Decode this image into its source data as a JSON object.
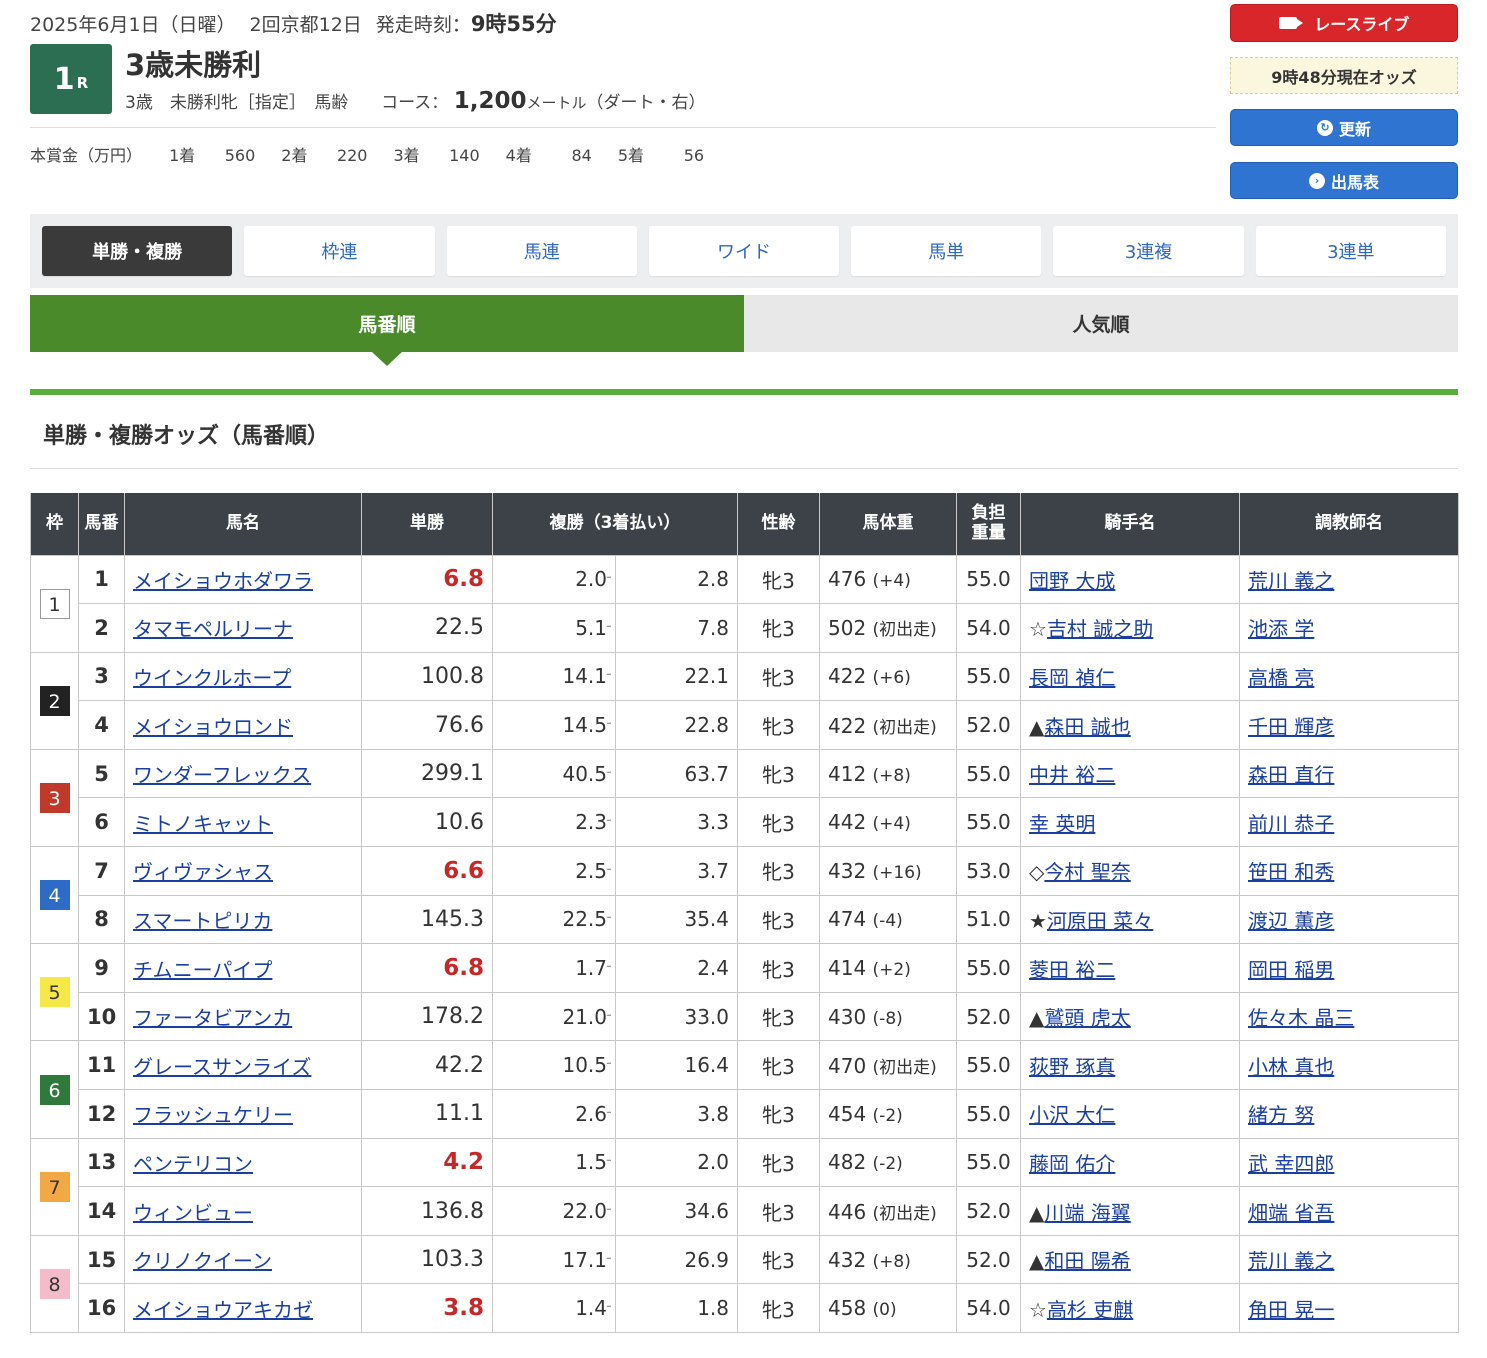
{
  "header": {
    "date": "2025年6月1日（日曜）",
    "meeting": "2回京都12日",
    "start_label": "発走時刻：",
    "start_time": "9時55分",
    "race_num": "1",
    "race_suffix": "R",
    "race_name": "3歳未勝利",
    "conditions": "3歳　未勝利牝［指定］　馬齢",
    "course_label": "コース：",
    "distance": "1,200",
    "unit": "メートル",
    "track": "（ダート・右）",
    "prize_label": "本賞金（万円）",
    "prizes": [
      {
        "place": "1着",
        "amount": "560"
      },
      {
        "place": "2着",
        "amount": "220"
      },
      {
        "place": "3着",
        "amount": "140"
      },
      {
        "place": "4着",
        "amount": "84"
      },
      {
        "place": "5着",
        "amount": "56"
      }
    ]
  },
  "side": {
    "live_label": "レースライブ",
    "odds_time": "9時48分現在オッズ",
    "update_label": "更新",
    "card_label": "出馬表"
  },
  "bet_tabs": [
    "単勝・複勝",
    "枠連",
    "馬連",
    "ワイド",
    "馬単",
    "3連複",
    "3連単"
  ],
  "sort_tabs": [
    "馬番順",
    "人気順"
  ],
  "section_title": "単勝・複勝オッズ（馬番順）",
  "columns": {
    "waku": "枠",
    "umaban": "馬番",
    "name": "馬名",
    "win": "単勝",
    "place": "複勝（3着払い）",
    "sex": "性齢",
    "weight": "馬体重",
    "burden1": "負担",
    "burden2": "重量",
    "jockey": "騎手名",
    "trainer": "調教師名"
  },
  "waku_colors": {
    "1": {
      "bg": "#ffffff",
      "fg": "#333333",
      "border": "#999999"
    },
    "2": {
      "bg": "#222222",
      "fg": "#ffffff",
      "border": "#222222"
    },
    "3": {
      "bg": "#c0392b",
      "fg": "#ffffff",
      "border": "#c0392b"
    },
    "4": {
      "bg": "#2e6bc4",
      "fg": "#ffffff",
      "border": "#2e6bc4"
    },
    "5": {
      "bg": "#f7e84a",
      "fg": "#333333",
      "border": "#f7e84a"
    },
    "6": {
      "bg": "#2f7a3a",
      "fg": "#ffffff",
      "border": "#2f7a3a"
    },
    "7": {
      "bg": "#f2a844",
      "fg": "#333333",
      "border": "#f2a844"
    },
    "8": {
      "bg": "#f4bccb",
      "fg": "#333333",
      "border": "#f4bccb"
    }
  },
  "horses": [
    {
      "waku": "1",
      "num": "1",
      "name": "メイショウホダワラ",
      "win": "6.8",
      "pop": true,
      "plc_lo": "2.0",
      "plc_hi": "2.8",
      "sex": "牝3",
      "wt": "476",
      "diff": "(+4)",
      "burden": "55.0",
      "mark": "",
      "jockey": "団野 大成",
      "trainer": "荒川 義之"
    },
    {
      "waku": "1",
      "num": "2",
      "name": "タマモペルリーナ",
      "win": "22.5",
      "pop": false,
      "plc_lo": "5.1",
      "plc_hi": "7.8",
      "sex": "牝3",
      "wt": "502",
      "diff": "(初出走)",
      "burden": "54.0",
      "mark": "☆",
      "jockey": "吉村 誠之助",
      "trainer": "池添 学"
    },
    {
      "waku": "2",
      "num": "3",
      "name": "ウインクルホープ",
      "win": "100.8",
      "pop": false,
      "plc_lo": "14.1",
      "plc_hi": "22.1",
      "sex": "牝3",
      "wt": "422",
      "diff": "(+6)",
      "burden": "55.0",
      "mark": "",
      "jockey": "長岡 禎仁",
      "trainer": "高橋 亮"
    },
    {
      "waku": "2",
      "num": "4",
      "name": "メイショウロンド",
      "win": "76.6",
      "pop": false,
      "plc_lo": "14.5",
      "plc_hi": "22.8",
      "sex": "牝3",
      "wt": "422",
      "diff": "(初出走)",
      "burden": "52.0",
      "mark": "▲",
      "jockey": "森田 誠也",
      "trainer": "千田 輝彦"
    },
    {
      "waku": "3",
      "num": "5",
      "name": "ワンダーフレックス",
      "win": "299.1",
      "pop": false,
      "plc_lo": "40.5",
      "plc_hi": "63.7",
      "sex": "牝3",
      "wt": "412",
      "diff": "(+8)",
      "burden": "55.0",
      "mark": "",
      "jockey": "中井 裕二",
      "trainer": "森田 直行"
    },
    {
      "waku": "3",
      "num": "6",
      "name": "ミトノキャット",
      "win": "10.6",
      "pop": false,
      "plc_lo": "2.3",
      "plc_hi": "3.3",
      "sex": "牝3",
      "wt": "442",
      "diff": "(+4)",
      "burden": "55.0",
      "mark": "",
      "jockey": "幸 英明",
      "trainer": "前川 恭子"
    },
    {
      "waku": "4",
      "num": "7",
      "name": "ヴィヴァシャス",
      "win": "6.6",
      "pop": true,
      "plc_lo": "2.5",
      "plc_hi": "3.7",
      "sex": "牝3",
      "wt": "432",
      "diff": "(+16)",
      "burden": "53.0",
      "mark": "◇",
      "jockey": "今村 聖奈",
      "trainer": "笹田 和秀"
    },
    {
      "waku": "4",
      "num": "8",
      "name": "スマートピリカ",
      "win": "145.3",
      "pop": false,
      "plc_lo": "22.5",
      "plc_hi": "35.4",
      "sex": "牝3",
      "wt": "474",
      "diff": "(-4)",
      "burden": "51.0",
      "mark": "★",
      "jockey": "河原田 菜々",
      "trainer": "渡辺 薫彦"
    },
    {
      "waku": "5",
      "num": "9",
      "name": "チムニーパイプ",
      "win": "6.8",
      "pop": true,
      "plc_lo": "1.7",
      "plc_hi": "2.4",
      "sex": "牝3",
      "wt": "414",
      "diff": "(+2)",
      "burden": "55.0",
      "mark": "",
      "jockey": "菱田 裕二",
      "trainer": "岡田 稲男"
    },
    {
      "waku": "5",
      "num": "10",
      "name": "ファータビアンカ",
      "win": "178.2",
      "pop": false,
      "plc_lo": "21.0",
      "plc_hi": "33.0",
      "sex": "牝3",
      "wt": "430",
      "diff": "(-8)",
      "burden": "52.0",
      "mark": "▲",
      "jockey": "鷲頭 虎太",
      "trainer": "佐々木 晶三"
    },
    {
      "waku": "6",
      "num": "11",
      "name": "グレースサンライズ",
      "win": "42.2",
      "pop": false,
      "plc_lo": "10.5",
      "plc_hi": "16.4",
      "sex": "牝3",
      "wt": "470",
      "diff": "(初出走)",
      "burden": "55.0",
      "mark": "",
      "jockey": "荻野 琢真",
      "trainer": "小林 真也"
    },
    {
      "waku": "6",
      "num": "12",
      "name": "フラッシュケリー",
      "win": "11.1",
      "pop": false,
      "plc_lo": "2.6",
      "plc_hi": "3.8",
      "sex": "牝3",
      "wt": "454",
      "diff": "(-2)",
      "burden": "55.0",
      "mark": "",
      "jockey": "小沢 大仁",
      "trainer": "緒方 努"
    },
    {
      "waku": "7",
      "num": "13",
      "name": "ペンテリコン",
      "win": "4.2",
      "pop": true,
      "plc_lo": "1.5",
      "plc_hi": "2.0",
      "sex": "牝3",
      "wt": "482",
      "diff": "(-2)",
      "burden": "55.0",
      "mark": "",
      "jockey": "藤岡 佑介",
      "trainer": "武 幸四郎"
    },
    {
      "waku": "7",
      "num": "14",
      "name": "ウィンビュー",
      "win": "136.8",
      "pop": false,
      "plc_lo": "22.0",
      "plc_hi": "34.6",
      "sex": "牝3",
      "wt": "446",
      "diff": "(初出走)",
      "burden": "52.0",
      "mark": "▲",
      "jockey": "川端 海翼",
      "trainer": "畑端 省吾"
    },
    {
      "waku": "8",
      "num": "15",
      "name": "クリノクイーン",
      "win": "103.3",
      "pop": false,
      "plc_lo": "17.1",
      "plc_hi": "26.9",
      "sex": "牝3",
      "wt": "432",
      "diff": "(+8)",
      "burden": "52.0",
      "mark": "▲",
      "jockey": "和田 陽希",
      "trainer": "荒川 義之"
    },
    {
      "waku": "8",
      "num": "16",
      "name": "メイショウアキカゼ",
      "win": "3.8",
      "pop": true,
      "plc_lo": "1.4",
      "plc_hi": "1.8",
      "sex": "牝3",
      "wt": "458",
      "diff": "(0)",
      "burden": "54.0",
      "mark": "☆",
      "jockey": "高杉 吏麒",
      "trainer": "角田 晃一"
    }
  ]
}
